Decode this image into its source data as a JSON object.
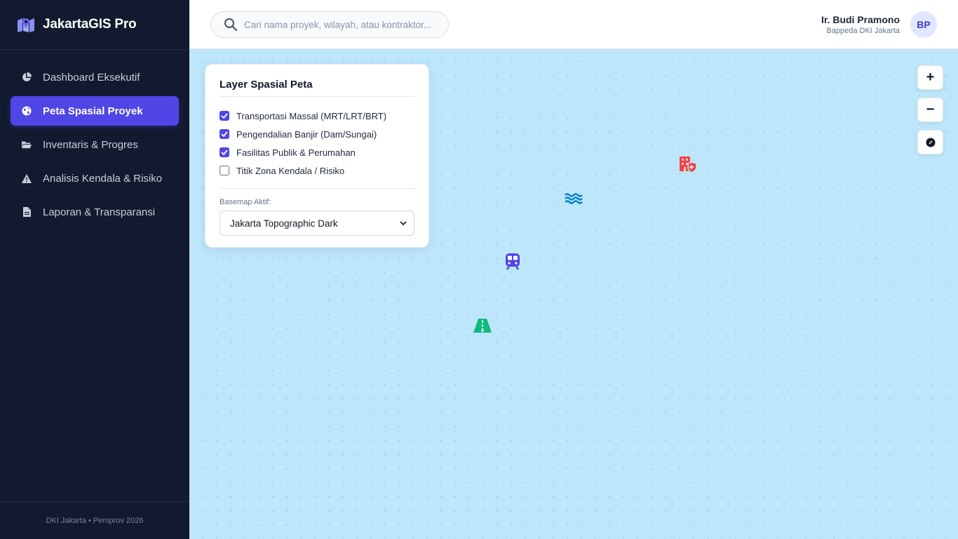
{
  "app": {
    "name": "JakartaGIS Pro"
  },
  "sidebar": {
    "items": [
      {
        "label": "Dashboard Eksekutif",
        "icon": "chart-pie-icon",
        "active": false
      },
      {
        "label": "Peta Spasial Proyek",
        "icon": "globe-icon",
        "active": true
      },
      {
        "label": "Inventaris & Progres",
        "icon": "folder-open-icon",
        "active": false
      },
      {
        "label": "Analisis Kendala & Risiko",
        "icon": "warning-icon",
        "active": false
      },
      {
        "label": "Laporan & Transparansi",
        "icon": "file-icon",
        "active": false
      }
    ],
    "footer": "DKI Jakarta • Pemprov 2026"
  },
  "search": {
    "placeholder": "Cari nama proyek, wilayah, atau kontraktor..."
  },
  "user": {
    "name": "Ir. Budi Pramono",
    "role": "Bappeda DKI Jakarta",
    "initials": "BP"
  },
  "layer_panel": {
    "title": "Layer Spasial Peta",
    "layers": [
      {
        "label": "Transportasi Massal (MRT/LRT/BRT)",
        "checked": true
      },
      {
        "label": "Pengendalian Banjir (Dam/Sungai)",
        "checked": true
      },
      {
        "label": "Fasilitas Publik & Perumahan",
        "checked": true
      },
      {
        "label": "Titik Zona Kendala / Risiko",
        "checked": false
      }
    ],
    "basemap_label": "Basemap Aktif:",
    "basemap_value": "Jakarta Topographic Dark"
  },
  "map_controls": {
    "zoom_in": "+",
    "zoom_out": "−"
  },
  "markers": [
    {
      "icon": "hospital-icon",
      "color": "#ef4444"
    },
    {
      "icon": "water-icon",
      "color": "#0284c7"
    },
    {
      "icon": "train-icon",
      "color": "#4f46e5"
    },
    {
      "icon": "road-icon",
      "color": "#10b981"
    }
  ],
  "colors": {
    "sidebar_bg": "#111a2e",
    "accent": "#4f46e5",
    "map_bg": "#bee6fb"
  }
}
